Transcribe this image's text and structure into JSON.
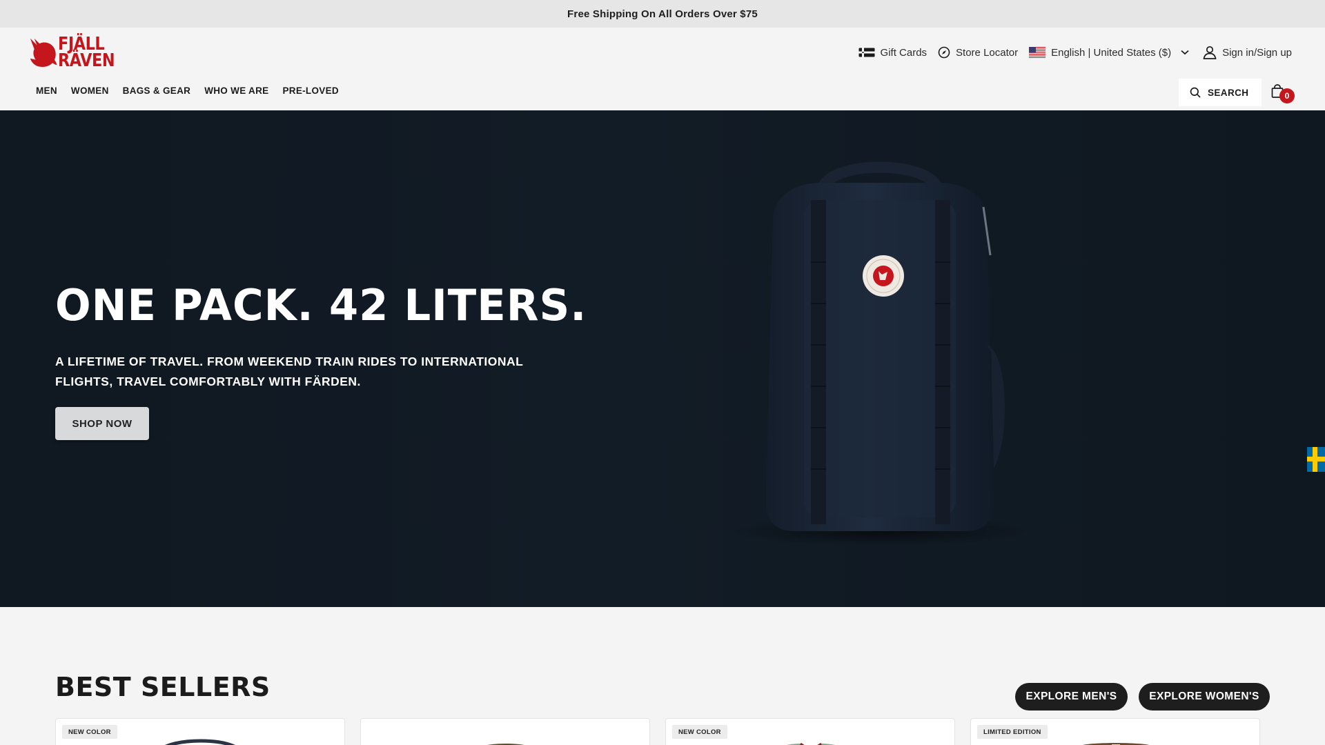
{
  "promo": {
    "text": "Free Shipping On All Orders Over $75"
  },
  "brand": {
    "line1": "FJÄLL",
    "line2": "RÄVEN",
    "color": "#c4161c"
  },
  "utility": {
    "gift_cards": "Gift Cards",
    "store_locator": "Store Locator",
    "language": "English | United States ($)",
    "sign_in": "Sign in/Sign up"
  },
  "nav": {
    "items": [
      "MEN",
      "WOMEN",
      "BAGS & GEAR",
      "WHO WE ARE",
      "PRE-LOVED"
    ]
  },
  "search": {
    "label": "SEARCH"
  },
  "cart": {
    "count": "0"
  },
  "hero": {
    "title": "ONE PACK. 42 LITERS.",
    "subtitle": "A LIFETIME OF TRAVEL. FROM WEEKEND TRAIN RIDES TO INTERNATIONAL FLIGHTS, TRAVEL COMFORTABLY WITH FÄRDEN.",
    "cta": "SHOP NOW",
    "background": "#111a23"
  },
  "best_sellers": {
    "title": "BEST SELLERS",
    "explore_mens": "EXPLORE MEN'S",
    "explore_womens": "EXPLORE WOMEN'S",
    "cards": [
      {
        "badge": "NEW COLOR"
      },
      {
        "badge": ""
      },
      {
        "badge": "NEW COLOR"
      },
      {
        "badge": "LIMITED EDITION"
      }
    ]
  },
  "icons": {
    "gift": "gift-card-icon",
    "compass": "compass-icon",
    "flag": "us-flag-icon",
    "chevron": "chevron-down-icon",
    "user": "user-icon",
    "search": "search-icon",
    "bag": "shopping-bag-icon",
    "sweden": "sweden-flag-icon"
  }
}
